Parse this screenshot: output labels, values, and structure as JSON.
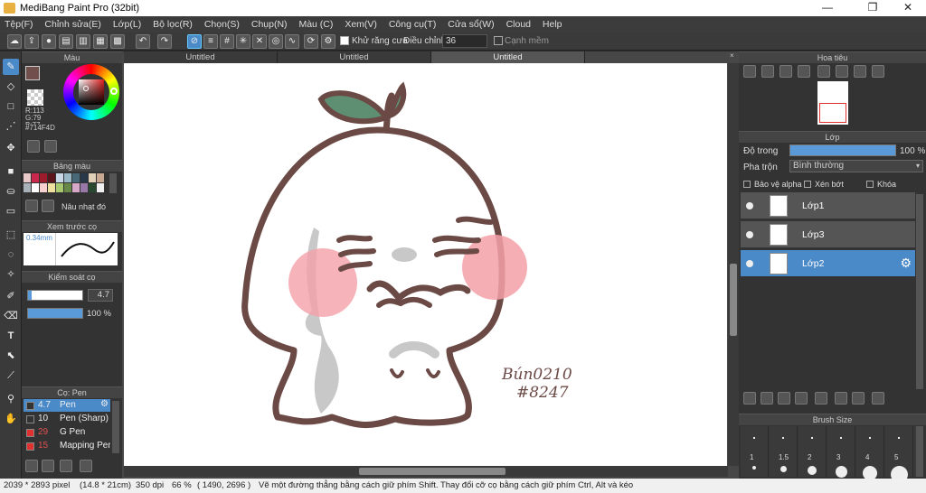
{
  "window": {
    "title": "MediBang Paint Pro (32bit)",
    "minimize": "—",
    "maximize": "❐",
    "close": "✕"
  },
  "menu": [
    "Tệp(F)",
    "Chỉnh sửa(E)",
    "Lớp(L)",
    "Bộ lọc(R)",
    "Chọn(S)",
    "Chụp(N)",
    "Màu (C)",
    "Xem(V)",
    "Công cụ(T)",
    "Cửa sổ(W)",
    "Cloud",
    "Help"
  ],
  "toolbar": {
    "antialias_label": "Khử răng cưa",
    "adjust_label": "Điều chỉnh",
    "adjust_value": "36",
    "smooth_label": "Cạnh mềm"
  },
  "tabs": [
    "Untitled",
    "Untitled",
    "Untitled"
  ],
  "color_panel": {
    "title": "Màu",
    "r": "R:113",
    "g": "G:79",
    "b": "B:77",
    "hex": "#714F4D",
    "fg_color": "#714F4D"
  },
  "palette_panel": {
    "title": "Bảng màu",
    "swatch_name": "Nâu nhạt đó",
    "swatches": [
      "#e8c8c8",
      "#c8284c",
      "#9c1c2c",
      "#5c141c",
      "#c8d8e8",
      "#98b8c8",
      "#486878",
      "#283848",
      "#e0d0b8",
      "#c8a890",
      "#a8b0b8",
      "#ffffff",
      "#f8d0d0",
      "#f0e0a0",
      "#a8c870",
      "#688848",
      "#d8a8c8",
      "#9878a8",
      "#284830",
      "#f0f0f0"
    ]
  },
  "brush_preview_panel": {
    "title": "Xem trước cọ",
    "size_text": "0.34mm"
  },
  "brush_control_panel": {
    "title": "Kiểm soát cọ",
    "size_value": "4.7",
    "opacity_value": "100 %",
    "opacity": 1.0
  },
  "brush_list": {
    "title": "Cọ: Pen",
    "items": [
      {
        "size": "4.7",
        "name": "Pen",
        "color": "#333333",
        "selected": true
      },
      {
        "size": "10",
        "name": "Pen (Sharp)",
        "color": "#333333",
        "selected": false
      },
      {
        "size": "29",
        "name": "G Pen",
        "color": "#e03030",
        "selected": false
      },
      {
        "size": "15",
        "name": "Mapping Pen",
        "color": "#e03030",
        "selected": false
      }
    ]
  },
  "navigator": {
    "title": "Hoa tiêu"
  },
  "layer_panel": {
    "title": "Lớp",
    "opacity_label": "Độ trong",
    "opacity_value": "100 %",
    "opacity": 1.0,
    "blend_label": "Pha trộn",
    "blend_value": "Bình thường",
    "alpha_label": "Bảo vệ alpha",
    "clip_label": "Xén bớt",
    "lock_label": "Khóa",
    "layers": [
      {
        "name": "Lớp1",
        "selected": false
      },
      {
        "name": "Lớp3",
        "selected": false
      },
      {
        "name": "Lớp2",
        "selected": true
      }
    ]
  },
  "brush_size_panel": {
    "title": "Brush Size",
    "labels": [
      "1",
      "1.5",
      "2",
      "3",
      "4",
      "5"
    ]
  },
  "canvas": {
    "signature_line1": "Bún0210",
    "signature_line2": "#8247"
  },
  "status": {
    "pixels": "2039 * 2893 pixel",
    "cm": "(14.8 * 21cm)",
    "dpi": "350 dpi",
    "zoom": "66 %",
    "coord": "( 1490, 2696 )",
    "hint": "Vẽ một đường thẳng bằng cách giữ phím Shift. Thay đổi cỡ cọ bằng cách giữ phím Ctrl, Alt và kéo"
  }
}
